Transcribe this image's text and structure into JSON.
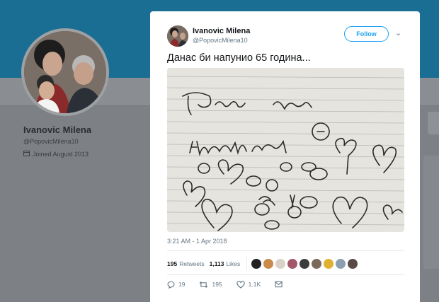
{
  "profile": {
    "name": "Ivanovic Milena",
    "handle": "@PopovicMilena10",
    "joined": "Joined August 2013"
  },
  "tweet": {
    "name": "Ivanovic Milena",
    "handle": "@PopovicMilena10",
    "follow_label": "Follow",
    "text": "Данас би напунио 65 година...",
    "timestamp": "3:21 AM - 1 Apr 2018",
    "retweets_count": "195",
    "retweets_label": "Retweets",
    "likes_count": "1,113",
    "likes_label": "Likes",
    "actions": {
      "reply": "19",
      "retweet": "195",
      "like": "1.1K"
    },
    "photo_words": [
      "Тата смешан",
      "кошензАн"
    ]
  },
  "colors": {
    "accent": "#1da1f2",
    "banner": "#1a6e93"
  }
}
